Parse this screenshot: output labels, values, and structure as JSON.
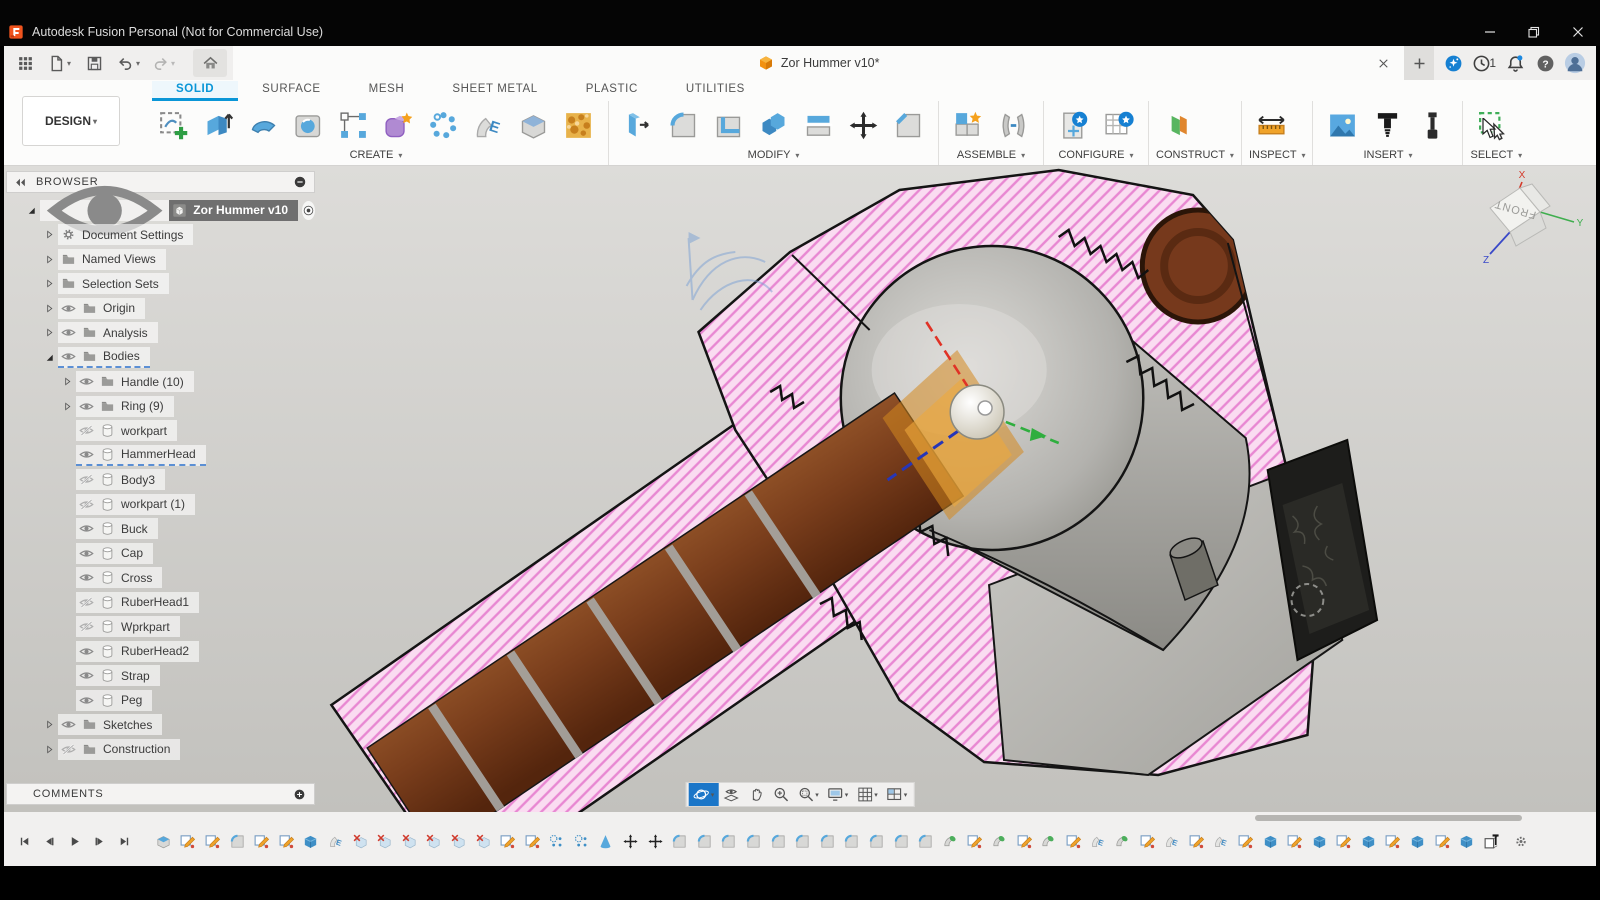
{
  "titlebar": {
    "title": "Autodesk Fusion Personal (Not for Commercial Use)"
  },
  "qat": {
    "left_icons": [
      "app-grid",
      "file",
      "save",
      "undo",
      "redo"
    ],
    "document_tab": {
      "label": "Zor Hummer v10*"
    },
    "job_count": "1"
  },
  "ribbon": {
    "design_label": "DESIGN",
    "tabs": [
      {
        "label": "SOLID",
        "active": true
      },
      {
        "label": "SURFACE",
        "active": false
      },
      {
        "label": "MESH",
        "active": false
      },
      {
        "label": "SHEET METAL",
        "active": false
      },
      {
        "label": "PLASTIC",
        "active": false
      },
      {
        "label": "UTILITIES",
        "active": false
      }
    ],
    "groups": [
      {
        "label": "CREATE",
        "icons": [
          "create-sketch",
          "extrude",
          "revolve",
          "hole",
          "pattern",
          "create-form",
          "coil",
          "emboss",
          "primitive-box",
          "volumetric-lattice"
        ]
      },
      {
        "label": "MODIFY",
        "icons": [
          "press-pull",
          "fillet",
          "shell",
          "combine",
          "split-body",
          "move-copy",
          "chamfer"
        ]
      },
      {
        "label": "ASSEMBLE",
        "icons": [
          "new-component",
          "joint"
        ]
      },
      {
        "label": "CONFIGURE",
        "icons": [
          "configuration",
          "configuration-table"
        ]
      },
      {
        "label": "CONSTRUCT",
        "icons": [
          "offset-plane"
        ]
      },
      {
        "label": "INSPECT",
        "icons": [
          "measure"
        ]
      },
      {
        "label": "INSERT",
        "icons": [
          "insert-image",
          "insert-screw",
          "insert-bolt"
        ]
      },
      {
        "label": "SELECT",
        "icons": [
          "select-window"
        ]
      }
    ]
  },
  "browser": {
    "header_label": "BROWSER",
    "comments_label": "COMMENTS",
    "tree": [
      {
        "label": "Zor Hummer v10",
        "level": 0,
        "expander": "down",
        "visibility": "on",
        "icon": "component-box",
        "selected": true,
        "radio": true
      },
      {
        "label": "Document Settings",
        "level": 1,
        "expander": "right",
        "icon": "gear"
      },
      {
        "label": "Named Views",
        "level": 1,
        "expander": "right",
        "icon": "folder"
      },
      {
        "label": "Selection Sets",
        "level": 1,
        "expander": "right",
        "icon": "folder"
      },
      {
        "label": "Origin",
        "level": 1,
        "expander": "right",
        "visibility": "on",
        "icon": "folder"
      },
      {
        "label": "Analysis",
        "level": 1,
        "expander": "right",
        "visibility": "on",
        "icon": "folder"
      },
      {
        "label": "Bodies",
        "level": 1,
        "expander": "down",
        "visibility": "on",
        "icon": "folder",
        "underline": true
      },
      {
        "label": "Handle (10)",
        "level": 2,
        "expander": "right",
        "visibility": "on",
        "icon": "folder"
      },
      {
        "label": "Ring (9)",
        "level": 2,
        "expander": "right",
        "visibility": "on",
        "icon": "folder"
      },
      {
        "label": "workpart",
        "level": 2,
        "expander": "none",
        "visibility": "off",
        "icon": "body"
      },
      {
        "label": "HammerHead",
        "level": 2,
        "expander": "none",
        "visibility": "on",
        "icon": "body",
        "underline": true
      },
      {
        "label": "Body3",
        "level": 2,
        "expander": "none",
        "visibility": "off",
        "icon": "body"
      },
      {
        "label": "workpart (1)",
        "level": 2,
        "expander": "none",
        "visibility": "off",
        "icon": "body"
      },
      {
        "label": "Buck",
        "level": 2,
        "expander": "none",
        "visibility": "on",
        "icon": "body"
      },
      {
        "label": "Cap",
        "level": 2,
        "expander": "none",
        "visibility": "on",
        "icon": "body"
      },
      {
        "label": "Cross",
        "level": 2,
        "expander": "none",
        "visibility": "on",
        "icon": "body"
      },
      {
        "label": "RuberHead1",
        "level": 2,
        "expander": "none",
        "visibility": "off",
        "icon": "body"
      },
      {
        "label": "Wprkpart",
        "level": 2,
        "expander": "none",
        "visibility": "off",
        "icon": "body"
      },
      {
        "label": "RuberHead2",
        "level": 2,
        "expander": "none",
        "visibility": "on",
        "icon": "body"
      },
      {
        "label": "Strap",
        "level": 2,
        "expander": "none",
        "visibility": "on",
        "icon": "body"
      },
      {
        "label": "Peg",
        "level": 2,
        "expander": "none",
        "visibility": "on",
        "icon": "body"
      },
      {
        "label": "Sketches",
        "level": 1,
        "expander": "right",
        "visibility": "on",
        "icon": "folder"
      },
      {
        "label": "Construction",
        "level": 1,
        "expander": "right",
        "visibility": "off",
        "icon": "folder"
      }
    ]
  },
  "viewcube": {
    "front_label": "FRONT",
    "x_label": "X",
    "y_label": "Y",
    "z_label": "Z"
  },
  "navbar": {
    "items": [
      {
        "icon": "orbit",
        "active": true,
        "dropdown": true
      },
      {
        "icon": "look-at",
        "active": false,
        "dropdown": false
      },
      {
        "icon": "pan",
        "active": false,
        "dropdown": false
      },
      {
        "icon": "zoom",
        "active": false,
        "dropdown": false
      },
      {
        "icon": "window-zoom",
        "active": false,
        "dropdown": true
      },
      {
        "icon": "display-settings",
        "active": false,
        "dropdown": true
      },
      {
        "icon": "layout-grid",
        "active": false,
        "dropdown": true
      },
      {
        "icon": "viewports",
        "active": false,
        "dropdown": true
      }
    ]
  },
  "timeline": {
    "playback_icons": [
      "skip-start",
      "step-back",
      "play",
      "step-forward",
      "skip-end"
    ],
    "features": [
      "extrude-top",
      "sketch",
      "sketch",
      "fillet",
      "sketch",
      "sketch",
      "extrude",
      "revolve",
      "suppress",
      "suppress",
      "suppress",
      "suppress",
      "suppress",
      "suppress",
      "sketch",
      "sketch",
      "pattern",
      "pattern",
      "cone",
      "move",
      "move",
      "fillet",
      "fillet",
      "fillet",
      "fillet",
      "fillet",
      "fillet",
      "fillet",
      "fillet",
      "fillet",
      "fillet",
      "fillet",
      "sweep",
      "sketch",
      "sweep",
      "sketch",
      "sweep",
      "sketch",
      "revolve",
      "sweep",
      "sketch",
      "revolve",
      "sketch",
      "revolve",
      "sketch",
      "extrude",
      "sketch",
      "extrude",
      "sketch",
      "extrude",
      "sketch",
      "extrude",
      "sketch",
      "extrude",
      "section"
    ]
  },
  "colors": {
    "accent_blue": "#0a96d7",
    "section_hatch_pink": "#f2b0e0",
    "selection_orange": "#e09a35",
    "handle_brown": "#7a3e1c"
  }
}
